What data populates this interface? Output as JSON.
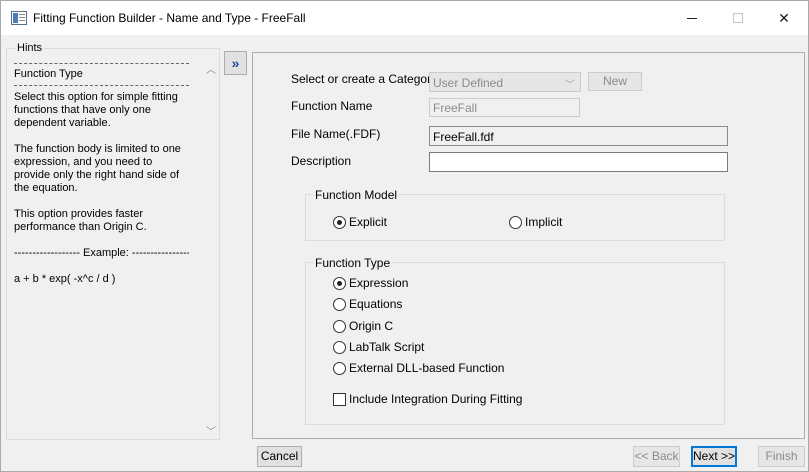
{
  "window": {
    "title": "Fitting Function Builder - Name and Type - FreeFall",
    "close_glyph": "✕"
  },
  "hints": {
    "legend": "Hints",
    "section_title": "Function Type",
    "paragraph1": "Select this option for simple fitting functions that have only one dependent variable.",
    "paragraph2": "The function body is limited to one expression, and you need to provide only the right hand side of the equation.",
    "paragraph3": "This option provides faster performance than Origin C.",
    "example_header": "------------------ Example: ------------------",
    "example": "a + b * exp( -x^c / d )"
  },
  "expand_button": {
    "glyph": "»"
  },
  "form": {
    "category_label": "Select or create a Category",
    "category_value": "User Defined",
    "new_label": "New",
    "function_name_label": "Function Name",
    "function_name_value": "FreeFall",
    "file_name_label": "File Name(.FDF)",
    "file_name_value": "FreeFall.fdf",
    "description_label": "Description",
    "description_value": ""
  },
  "function_model": {
    "legend": "Function Model",
    "options": [
      {
        "label": "Explicit",
        "selected": true
      },
      {
        "label": "Implicit",
        "selected": false
      }
    ]
  },
  "function_type": {
    "legend": "Function Type",
    "options": [
      {
        "label": "Expression",
        "selected": true
      },
      {
        "label": "Equations",
        "selected": false
      },
      {
        "label": "Origin C",
        "selected": false
      },
      {
        "label": "LabTalk Script",
        "selected": false
      },
      {
        "label": "External DLL-based Function",
        "selected": false
      }
    ],
    "include_integration_label": "Include Integration During Fitting",
    "include_integration_checked": false
  },
  "buttons": {
    "cancel": "Cancel",
    "back": "<< Back",
    "next": "Next >>",
    "finish": "Finish"
  }
}
